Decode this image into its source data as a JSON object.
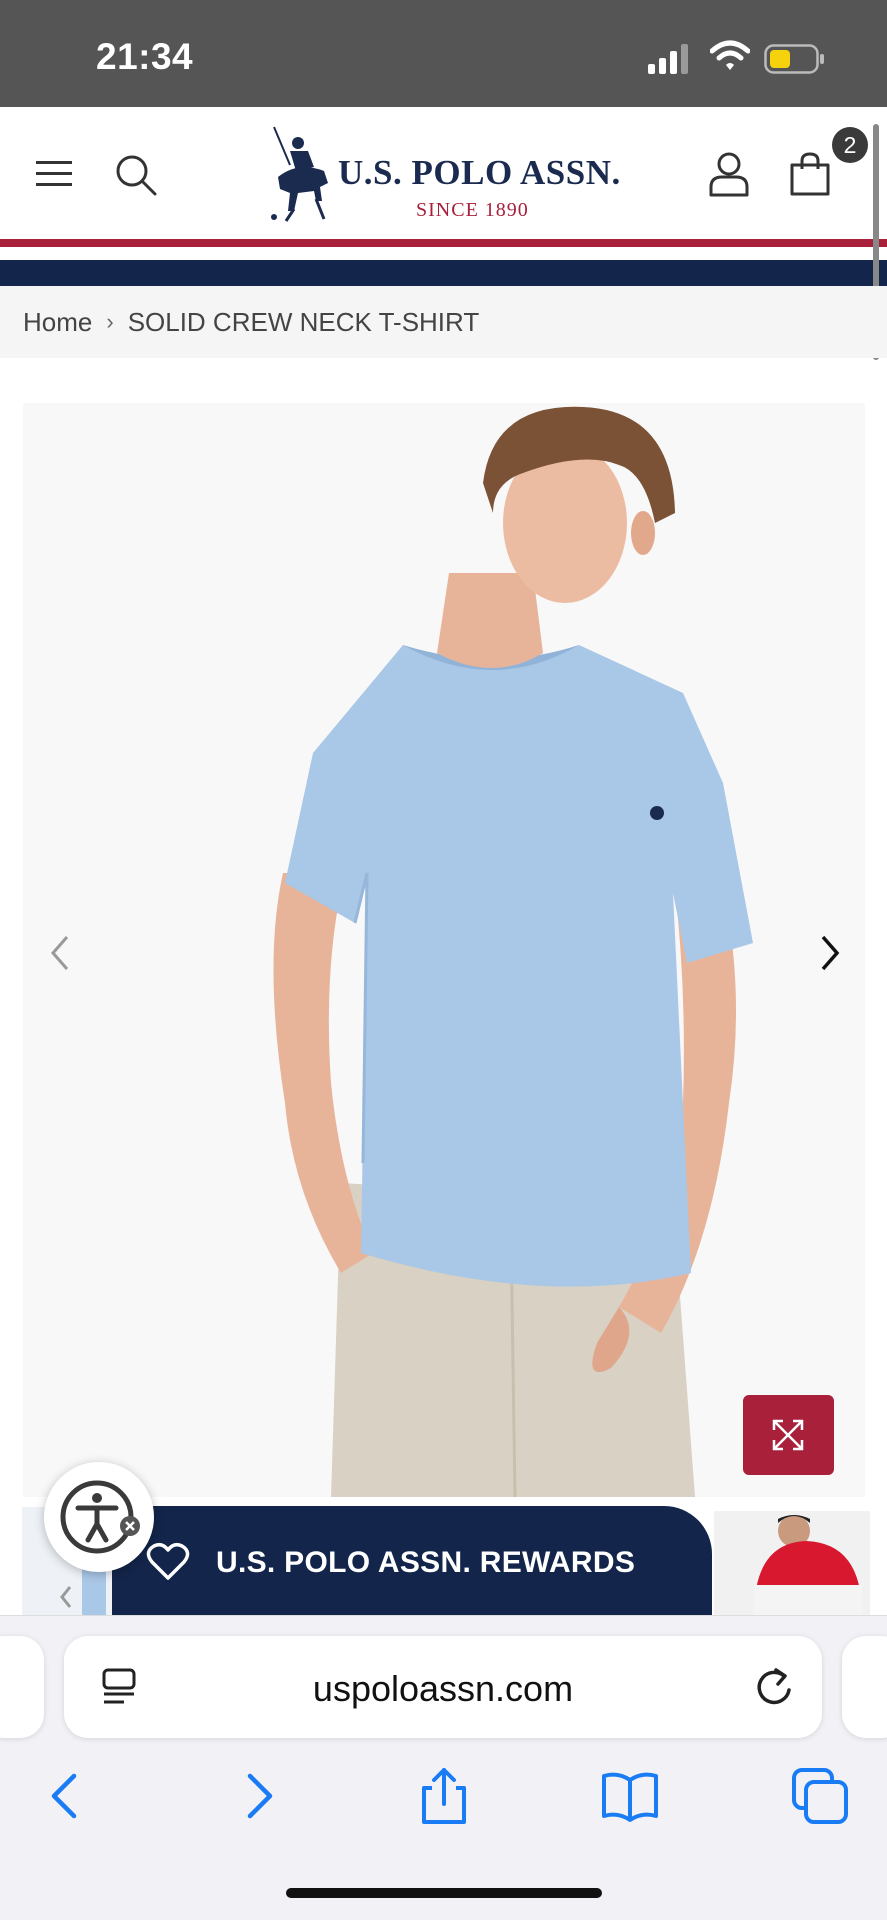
{
  "status_bar": {
    "time": "21:34"
  },
  "header": {
    "logo_name": "U.S. POLO ASSN.",
    "logo_since": "SINCE 1890",
    "cart_count": "2"
  },
  "breadcrumb": {
    "home": "Home",
    "separator": "›",
    "current": "SOLID CREW NECK T-SHIRT"
  },
  "rewards": {
    "label": "U.S. POLO ASSN. REWARDS"
  },
  "browser": {
    "url": "uspoloassn.com"
  },
  "colors": {
    "brand_navy": "#13254a",
    "brand_red": "#a8203a",
    "shirt_blue": "#a9c7e6",
    "safari_blue": "#1a7cf5"
  },
  "icons": [
    "menu-icon",
    "search-icon",
    "account-icon",
    "cart-icon",
    "chevron-left-icon",
    "chevron-right-icon",
    "expand-icon",
    "heart-icon",
    "accessibility-icon",
    "reader-icon",
    "reload-icon",
    "back-icon",
    "forward-icon",
    "share-icon",
    "bookmarks-icon",
    "tabs-icon"
  ]
}
